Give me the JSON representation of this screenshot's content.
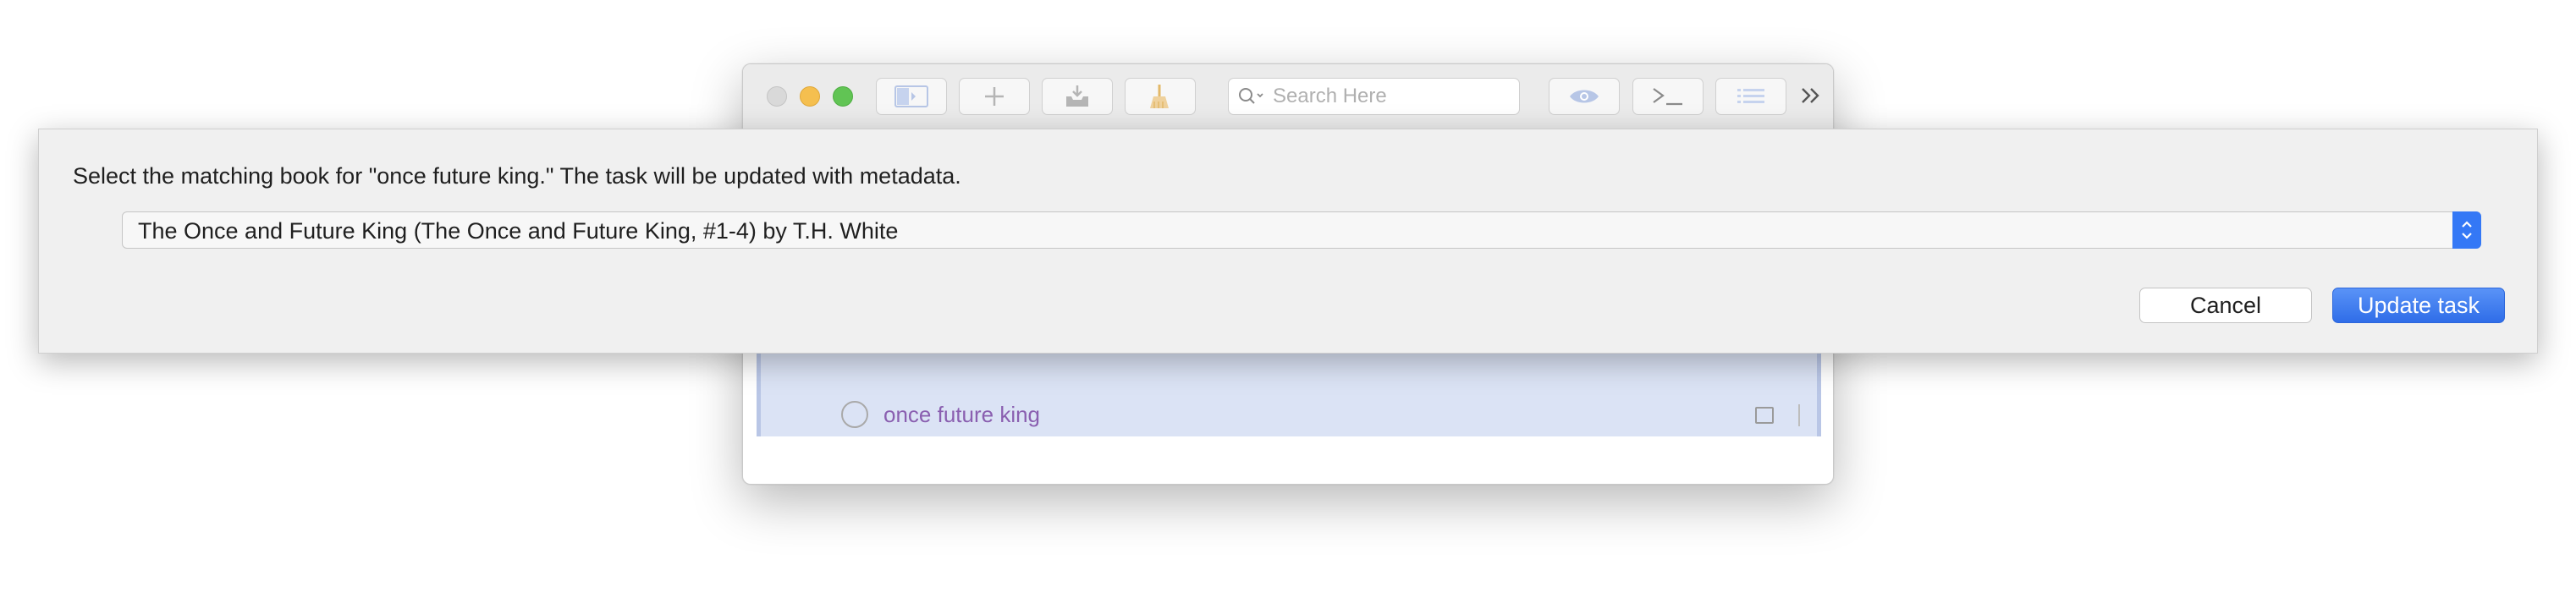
{
  "app_window": {
    "toolbar": {
      "search_placeholder": "Search Here"
    },
    "task_row": {
      "title": "once future king"
    }
  },
  "sheet": {
    "message": "Select the matching book for \"once future king.\" The task will be updated with metadata.",
    "book_select": {
      "selected": "The Once and Future King (The Once and Future King, #1-4) by T.H. White"
    },
    "cancel_label": "Cancel",
    "update_label": "Update task"
  },
  "colors": {
    "accent": "#3478f6",
    "task_title": "#8a5fb0",
    "selected_row": "#dbe3f5"
  },
  "icons": [
    "sidebar-toggle-icon",
    "plus-icon",
    "download-tray-icon",
    "broom-icon",
    "search-icon",
    "eye-icon",
    "terminal-icon",
    "list-icon",
    "chevron-double-right-icon",
    "stepper-updown-icon"
  ]
}
